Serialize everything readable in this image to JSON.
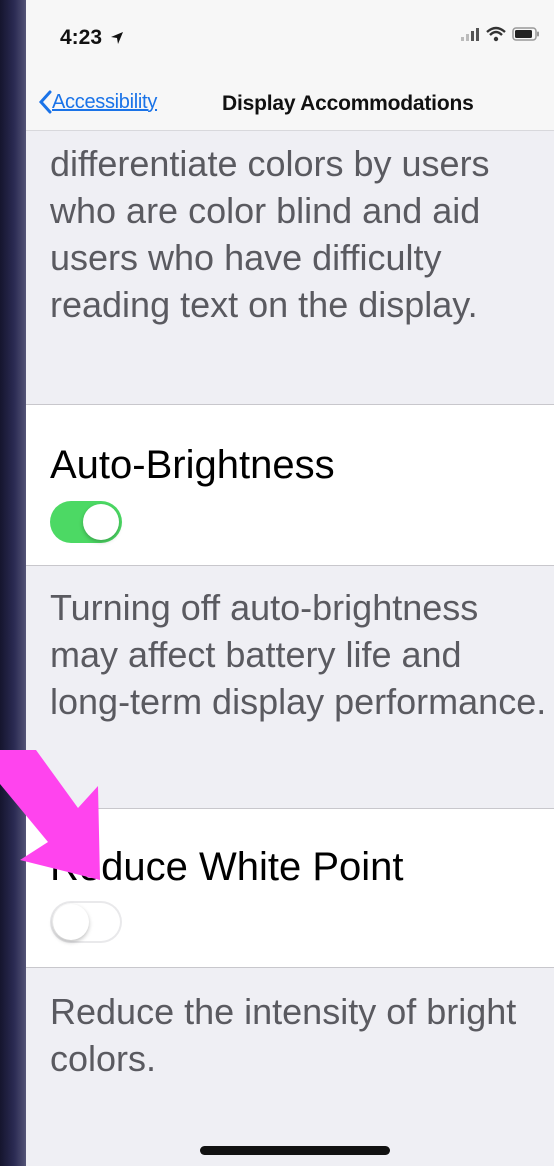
{
  "status_bar": {
    "time": "4:23",
    "location_icon": "location-arrow-icon",
    "signal_icon": "cellular-signal-icon",
    "wifi_icon": "wifi-icon",
    "battery_icon": "battery-icon"
  },
  "nav": {
    "back_label": "Accessibility",
    "title": "Display Accommodations"
  },
  "sections": {
    "color_filters_footer": "differentiate colors by users who are color blind and aid users who have difficulty reading text on the display.",
    "auto_brightness": {
      "label": "Auto-Brightness",
      "on": true,
      "footer": "Turning off auto-brightness may affect battery life and long-term display performance."
    },
    "reduce_white_point": {
      "label": "Reduce White Point",
      "on": false,
      "footer": "Reduce the intensity of bright colors."
    }
  },
  "colors": {
    "toggle_on": "#4cd964",
    "toggle_off": "#e9e9eb",
    "link_blue": "#1a73e8",
    "annotation_arrow": "#ff44ee"
  }
}
